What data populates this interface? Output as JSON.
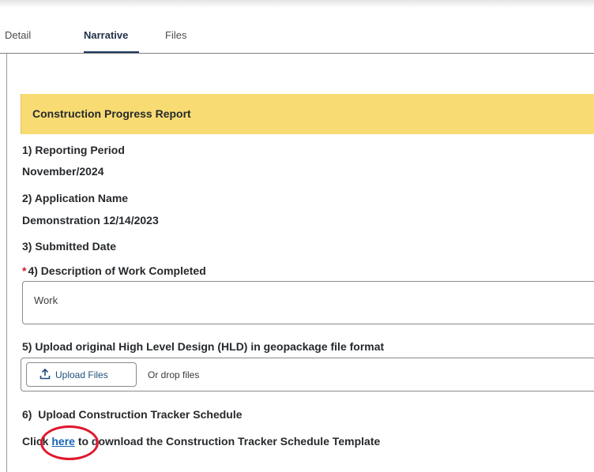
{
  "tabs": [
    {
      "label": "Detail"
    },
    {
      "label": "Narrative"
    },
    {
      "label": "Files"
    }
  ],
  "active_tab": "Narrative",
  "section_title": "Construction Progress Report",
  "fields": {
    "reporting_period_label": "1) Reporting Period",
    "reporting_period_value": "November/2024",
    "application_name_label": "2) Application Name",
    "application_name_value": "Demonstration 12/14/2023",
    "submitted_date_label": "3) Submitted Date",
    "description_label": "4) Description of Work Completed",
    "description_required_marker": "*",
    "description_value": "Work",
    "hld_label": "5) Upload original High Level Design (HLD) in geopackage file format",
    "upload_button_label": "Upload Files",
    "drop_text": "Or drop files",
    "tracker_label": "6)  Upload Construction Tracker Schedule",
    "download_prefix": "Click ",
    "download_link": "here",
    "download_suffix": " to download the Construction Tracker Schedule Template"
  },
  "colors": {
    "section_header_bg": "#f8dc73",
    "link": "#1566b5",
    "required": "#d11a2a",
    "annotation": "#e0182d"
  },
  "icons": {
    "upload": "upload-icon"
  }
}
